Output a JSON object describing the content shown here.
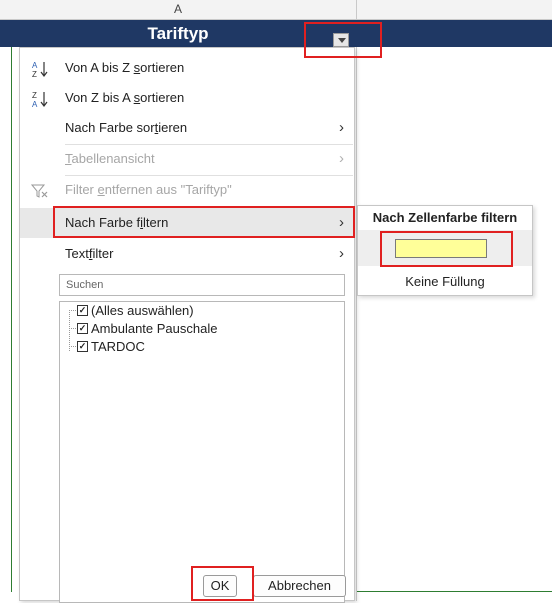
{
  "sheet": {
    "column_letter": "A",
    "table_header_title": "Tariftyp"
  },
  "menu": {
    "sort_az": {
      "icon": "sort-ascending-icon",
      "pre": "Von A bis Z ",
      "u": "s",
      "post": "ortieren"
    },
    "sort_za": {
      "icon": "sort-descending-icon",
      "pre": "Von Z bis A ",
      "u": "s",
      "post": "ortieren"
    },
    "sort_color": {
      "pre": "Nach Farbe sor",
      "u": "t",
      "post": "ieren"
    },
    "table_view": {
      "pre": "",
      "u": "T",
      "post": "abellenansicht"
    },
    "clear_filter": {
      "icon": "clear-filter-icon",
      "pre": "Filter ",
      "u": "e",
      "post": "ntfernen aus \"Tariftyp\""
    },
    "filter_color": {
      "pre": "Nach Farbe f",
      "u": "i",
      "post": "ltern"
    },
    "text_filter": {
      "pre": "Text",
      "u": "f",
      "post": "ilter"
    },
    "search_placeholder": "Suchen",
    "list_items": [
      {
        "label": "(Alles auswählen)",
        "checked": true
      },
      {
        "label": "Ambulante Pauschale",
        "checked": true
      },
      {
        "label": "TARDOC",
        "checked": true
      }
    ],
    "ok_label": "OK",
    "cancel_label": "Abbrechen"
  },
  "submenu": {
    "title": "Nach Zellenfarbe filtern",
    "swatch_color": "#ffff99",
    "no_fill_label": "Keine Füllung"
  },
  "colors": {
    "header_bg": "#1f3864",
    "highlight": "#e02020"
  }
}
